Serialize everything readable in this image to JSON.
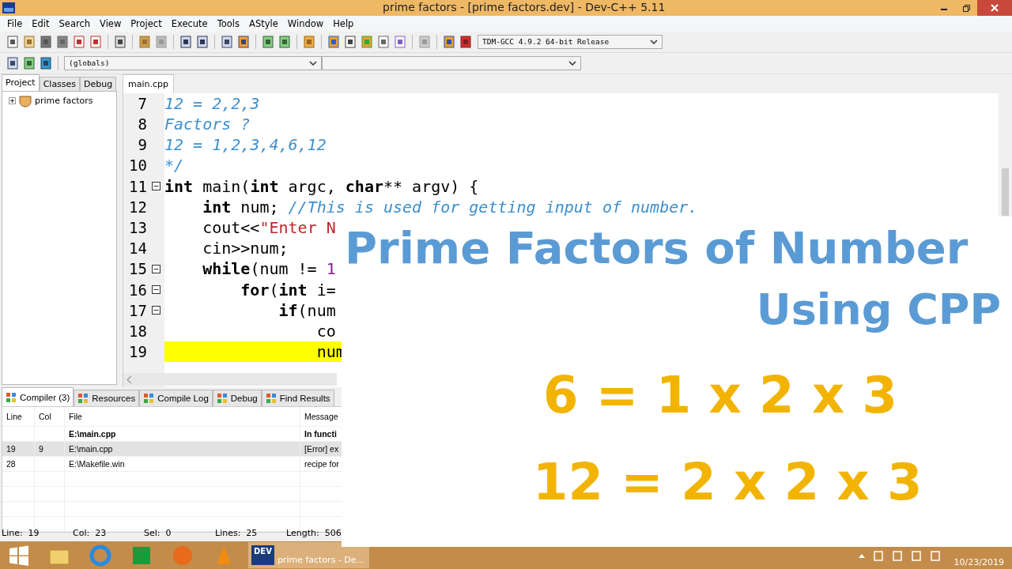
{
  "window": {
    "title": "prime factors - [prime factors.dev] - Dev-C++ 5.11"
  },
  "menu": [
    "File",
    "Edit",
    "Search",
    "View",
    "Project",
    "Execute",
    "Tools",
    "AStyle",
    "Window",
    "Help"
  ],
  "toolbar": {
    "compiler_select": "TDM-GCC 4.9.2 64-bit Release",
    "scope_select": "(globals)"
  },
  "left_tabs": [
    {
      "label": "Project",
      "selected": true
    },
    {
      "label": "Classes",
      "selected": false
    },
    {
      "label": "Debug",
      "selected": false
    }
  ],
  "project_tree": [
    {
      "label": "prime factors",
      "expanded": false
    }
  ],
  "editor_tabs": [
    {
      "label": "main.cpp",
      "selected": true
    }
  ],
  "code_lines": [
    {
      "number": "7",
      "fold": false,
      "highlighted": false,
      "segments": [
        {
          "kind": "comment",
          "text": "12 = 2,2,3"
        }
      ]
    },
    {
      "number": "8",
      "fold": false,
      "highlighted": false,
      "segments": [
        {
          "kind": "comment",
          "text": "Factors ?"
        }
      ]
    },
    {
      "number": "9",
      "fold": false,
      "highlighted": false,
      "segments": [
        {
          "kind": "comment",
          "text": "12 = 1,2,3,4,6,12"
        }
      ]
    },
    {
      "number": "10",
      "fold": false,
      "highlighted": false,
      "segments": [
        {
          "kind": "comment",
          "text": "*/"
        }
      ]
    },
    {
      "number": "11",
      "fold": true,
      "highlighted": false,
      "segments": [
        {
          "kind": "keyword",
          "text": "int"
        },
        {
          "kind": "plain",
          "text": " main("
        },
        {
          "kind": "keyword",
          "text": "int"
        },
        {
          "kind": "plain",
          "text": " argc, "
        },
        {
          "kind": "keyword",
          "text": "char"
        },
        {
          "kind": "plain",
          "text": "** argv) {"
        }
      ]
    },
    {
      "number": "12",
      "fold": false,
      "highlighted": false,
      "segments": [
        {
          "kind": "keyword",
          "text": "    int"
        },
        {
          "kind": "plain",
          "text": " num; "
        },
        {
          "kind": "comment",
          "text": "//This is used for getting input of number."
        }
      ]
    },
    {
      "number": "13",
      "fold": false,
      "highlighted": false,
      "segments": [
        {
          "kind": "plain",
          "text": "    cout<<"
        },
        {
          "kind": "string",
          "text": "\"Enter N"
        }
      ]
    },
    {
      "number": "14",
      "fold": false,
      "highlighted": false,
      "segments": [
        {
          "kind": "plain",
          "text": "    cin>>num;"
        }
      ]
    },
    {
      "number": "15",
      "fold": true,
      "highlighted": false,
      "segments": [
        {
          "kind": "keyword",
          "text": "    while"
        },
        {
          "kind": "plain",
          "text": "(num != "
        },
        {
          "kind": "number",
          "text": "1"
        }
      ]
    },
    {
      "number": "16",
      "fold": true,
      "highlighted": false,
      "segments": [
        {
          "kind": "keyword",
          "text": "        for"
        },
        {
          "kind": "plain",
          "text": "("
        },
        {
          "kind": "keyword",
          "text": "int"
        },
        {
          "kind": "plain",
          "text": " i="
        }
      ]
    },
    {
      "number": "17",
      "fold": true,
      "highlighted": false,
      "segments": [
        {
          "kind": "keyword",
          "text": "            if"
        },
        {
          "kind": "plain",
          "text": "(num"
        }
      ]
    },
    {
      "number": "18",
      "fold": false,
      "highlighted": false,
      "segments": [
        {
          "kind": "plain",
          "text": "                co"
        }
      ]
    },
    {
      "number": "19",
      "fold": false,
      "highlighted": true,
      "segments": [
        {
          "kind": "plain",
          "text": "                num"
        }
      ]
    }
  ],
  "bottom_tabs": [
    {
      "label": "Compiler (3)",
      "selected": true
    },
    {
      "label": "Resources",
      "selected": false
    },
    {
      "label": "Compile Log",
      "selected": false
    },
    {
      "label": "Debug",
      "selected": false
    },
    {
      "label": "Find Results",
      "selected": false
    }
  ],
  "messages": {
    "columns": [
      "Line",
      "Col",
      "File",
      "Message"
    ],
    "rows": [
      {
        "file": "E:\\main.cpp",
        "message": "In functi",
        "bold": true,
        "selected": false
      },
      {
        "line": "19",
        "col": "9",
        "file": "E:\\main.cpp",
        "message": "[Error] ex",
        "bold": false,
        "selected": true
      },
      {
        "line": "28",
        "file": "E:\\Makefile.win",
        "message": "recipe for",
        "bold": false,
        "selected": false
      }
    ]
  },
  "status_bar": [
    {
      "label": "Line:",
      "value": "19"
    },
    {
      "label": "Col:",
      "value": "23"
    },
    {
      "label": "Sel:",
      "value": "0"
    },
    {
      "label": "Lines:",
      "value": "25"
    },
    {
      "label": "Length:",
      "value": "506"
    }
  ],
  "overlay": {
    "title": "Prime Factors of Number",
    "subtitle": "Using CPP",
    "examples": [
      "6 = 1 x 2 x 3",
      "12 = 2 x 2 x 3"
    ]
  },
  "taskbar": {
    "app_icon_text": "DEV",
    "task_label": "prime factors - De...",
    "date": "10/23/2019"
  }
}
